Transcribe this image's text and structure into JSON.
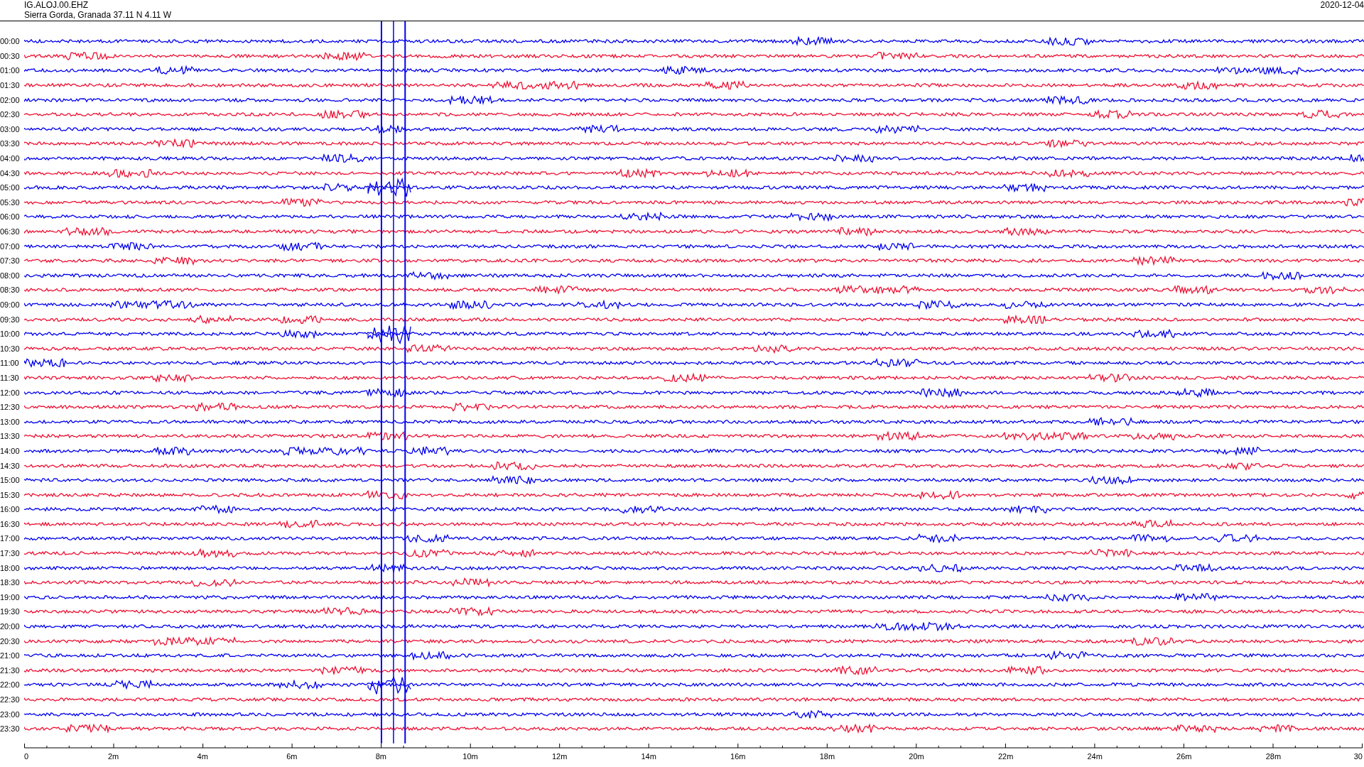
{
  "header": {
    "station": "IG.ALOJ.00.EHZ",
    "location": "Sierra Gorda, Granada  37.11 N 4.11 W",
    "date": "2020-12-04"
  },
  "rows": [
    {
      "time": "00:00",
      "color": "#0000ee"
    },
    {
      "time": "00:30",
      "color": "#ee1133"
    },
    {
      "time": "01:00",
      "color": "#0000ee"
    },
    {
      "time": "01:30",
      "color": "#ee1133"
    },
    {
      "time": "02:00",
      "color": "#0000ee"
    },
    {
      "time": "02:30",
      "color": "#ee1133"
    },
    {
      "time": "03:00",
      "color": "#0000ee"
    },
    {
      "time": "03:30",
      "color": "#ee1133"
    },
    {
      "time": "04:00",
      "color": "#0000ee"
    },
    {
      "time": "04:30",
      "color": "#ee1133"
    },
    {
      "time": "05:00",
      "color": "#0000ee"
    },
    {
      "time": "05:30",
      "color": "#ee1133"
    },
    {
      "time": "06:00",
      "color": "#0000ee"
    },
    {
      "time": "06:30",
      "color": "#ee1133"
    },
    {
      "time": "07:00",
      "color": "#0000ee"
    },
    {
      "time": "07:30",
      "color": "#ee1133"
    },
    {
      "time": "08:00",
      "color": "#0000ee"
    },
    {
      "time": "08:30",
      "color": "#ee1133"
    },
    {
      "time": "09:00",
      "color": "#0000ee"
    },
    {
      "time": "09:30",
      "color": "#ee1133"
    },
    {
      "time": "10:00",
      "color": "#0000ee"
    },
    {
      "time": "10:30",
      "color": "#ee1133"
    },
    {
      "time": "11:00",
      "color": "#0000ee"
    },
    {
      "time": "11:30",
      "color": "#ee1133"
    },
    {
      "time": "12:00",
      "color": "#0000ee"
    },
    {
      "time": "12:30",
      "color": "#ee1133"
    },
    {
      "time": "13:00",
      "color": "#0000ee"
    },
    {
      "time": "13:30",
      "color": "#ee1133"
    },
    {
      "time": "14:00",
      "color": "#0000ee"
    },
    {
      "time": "14:30",
      "color": "#ee1133"
    },
    {
      "time": "15:00",
      "color": "#0000ee"
    },
    {
      "time": "15:30",
      "color": "#ee1133"
    },
    {
      "time": "16:00",
      "color": "#0000ee"
    },
    {
      "time": "16:30",
      "color": "#ee1133"
    },
    {
      "time": "17:00",
      "color": "#0000ee"
    },
    {
      "time": "17:30",
      "color": "#ee1133"
    },
    {
      "time": "18:00",
      "color": "#0000ee"
    },
    {
      "time": "18:30",
      "color": "#ee1133"
    },
    {
      "time": "19:00",
      "color": "#0000ee"
    },
    {
      "time": "19:30",
      "color": "#ee1133"
    },
    {
      "time": "20:00",
      "color": "#0000ee"
    },
    {
      "time": "20:30",
      "color": "#ee1133"
    },
    {
      "time": "21:00",
      "color": "#0000ee"
    },
    {
      "time": "21:30",
      "color": "#ee1133"
    },
    {
      "time": "22:00",
      "color": "#0000ee"
    },
    {
      "time": "22:30",
      "color": "#ee1133"
    },
    {
      "time": "23:00",
      "color": "#0000ee"
    },
    {
      "time": "23:30",
      "color": "#ee1133"
    }
  ],
  "axis": {
    "labels": [
      "0",
      "2m",
      "4m",
      "6m",
      "8m",
      "10m",
      "12m",
      "14m",
      "16m",
      "18m",
      "20m",
      "22m",
      "24m",
      "26m",
      "28m",
      "30"
    ]
  }
}
